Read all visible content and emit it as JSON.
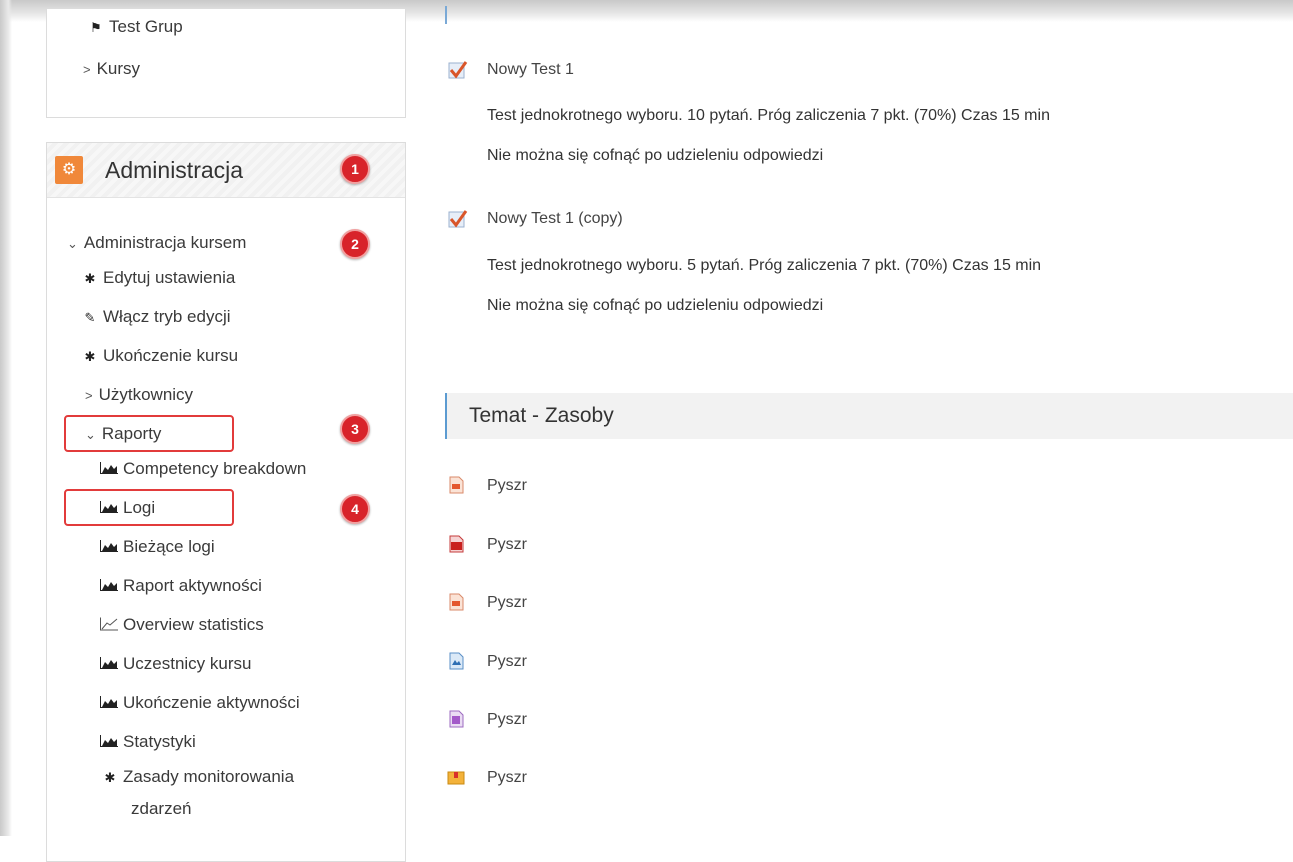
{
  "nav": {
    "items": [
      {
        "label": "Test Grup",
        "icon": "flag-icon"
      },
      {
        "label": "Kursy",
        "icon": "chevron-right-icon"
      }
    ]
  },
  "admin": {
    "title": "Administracja",
    "icon": "cogs-icon",
    "accent": "#f0883a",
    "course_admin": "Administracja kursem",
    "items": [
      {
        "label": "Edytuj ustawienia",
        "icon": "gear-icon"
      },
      {
        "label": "Włącz tryb edycji",
        "icon": "pencil-icon"
      },
      {
        "label": "Ukończenie kursu",
        "icon": "gear-icon"
      },
      {
        "label": "Użytkownicy",
        "icon": "chevron-right-icon"
      },
      {
        "label": "Raporty",
        "icon": "chevron-down-icon"
      }
    ],
    "reports": [
      {
        "label": "Competency breakdown",
        "icon": "area-chart-icon"
      },
      {
        "label": "Logi",
        "icon": "area-chart-icon"
      },
      {
        "label": "Bieżące logi",
        "icon": "area-chart-icon"
      },
      {
        "label": "Raport aktywności",
        "icon": "area-chart-icon"
      },
      {
        "label": "Overview statistics",
        "icon": "line-chart-icon"
      },
      {
        "label": "Uczestnicy kursu",
        "icon": "area-chart-icon"
      },
      {
        "label": "Ukończenie aktywności",
        "icon": "area-chart-icon"
      },
      {
        "label": "Statystyki",
        "icon": "area-chart-icon"
      }
    ],
    "monitoring_line1": "Zasady monitorowania",
    "monitoring_line2": "zdarzeń"
  },
  "badges": [
    "1",
    "2",
    "3",
    "4"
  ],
  "badge_color": "#d8232a",
  "activities": [
    {
      "title": "Nowy Test 1",
      "desc1": "Test jednokrotnego wyboru. 10 pytań. Próg zaliczenia 7 pkt. (70%) Czas 15 min",
      "desc2": "Nie można się cofnąć po udzieleniu odpowiedzi"
    },
    {
      "title": "Nowy Test 1 (copy)",
      "desc1": "Test jednokrotnego wyboru. 5 pytań. Próg zaliczenia 7 pkt. (70%) Czas 15 min",
      "desc2": "Nie można się cofnąć po udzieleniu odpowiedzi"
    }
  ],
  "section": {
    "title": "Temat - Zasoby"
  },
  "resources": [
    {
      "label": "Pyszr",
      "icon": "ppt-file-icon"
    },
    {
      "label": "Pyszr",
      "icon": "pdf-file-icon"
    },
    {
      "label": "Pyszr",
      "icon": "ppt-file-icon"
    },
    {
      "label": "Pyszr",
      "icon": "image-file-icon"
    },
    {
      "label": "Pyszr",
      "icon": "archive-file-icon"
    },
    {
      "label": "Pyszr",
      "icon": "package-icon"
    }
  ]
}
